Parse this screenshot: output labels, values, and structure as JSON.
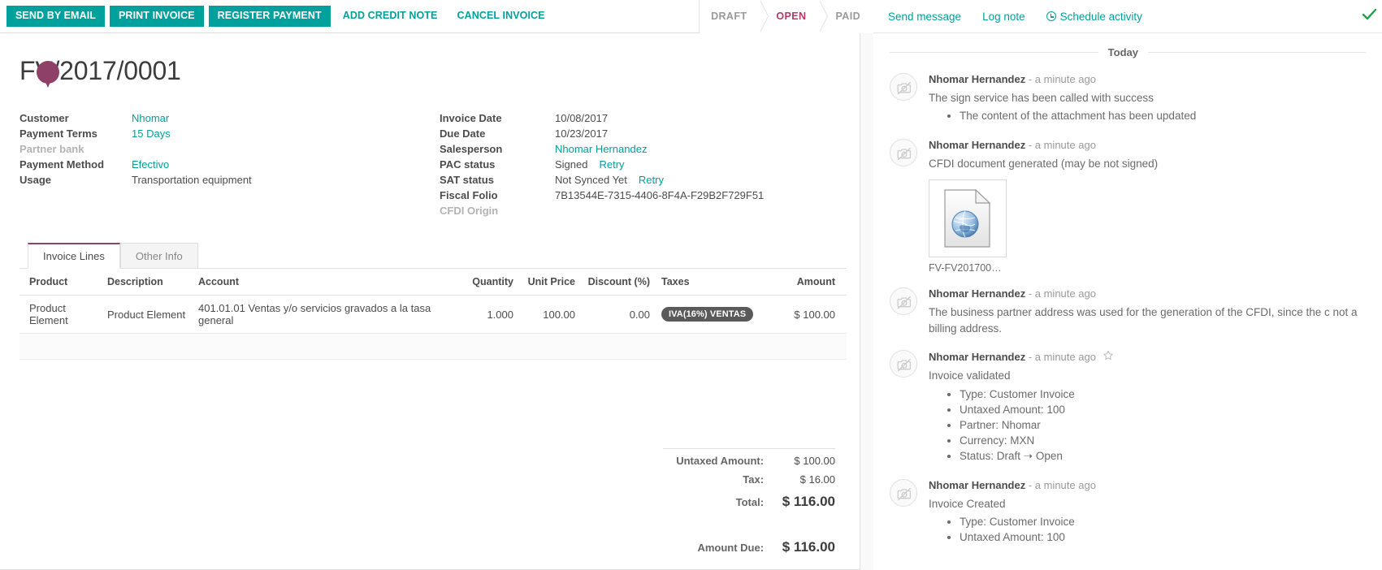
{
  "toolbar": {
    "buttons": [
      {
        "label": "SEND BY EMAIL",
        "style": "primary",
        "name": "send-by-email-button"
      },
      {
        "label": "PRINT INVOICE",
        "style": "primary",
        "name": "print-invoice-button"
      },
      {
        "label": "REGISTER PAYMENT",
        "style": "primary",
        "name": "register-payment-button"
      },
      {
        "label": "ADD CREDIT NOTE",
        "style": "link",
        "name": "add-credit-note-button"
      },
      {
        "label": "CANCEL INVOICE",
        "style": "link",
        "name": "cancel-invoice-button"
      }
    ]
  },
  "statusbar": {
    "steps": [
      {
        "label": "DRAFT",
        "active": false
      },
      {
        "label": "OPEN",
        "active": true
      },
      {
        "label": "PAID",
        "active": false
      }
    ],
    "active_color": "#b5396b",
    "inactive_color": "#9a9a9a"
  },
  "record": {
    "title": "FV/2017/0001"
  },
  "fields_left": [
    {
      "label": "Customer",
      "value": "Nhomar",
      "link": true,
      "muted": false
    },
    {
      "label": "Payment Terms",
      "value": "15 Days",
      "link": true,
      "muted": false
    },
    {
      "label": "Partner bank",
      "value": "",
      "link": false,
      "muted": true
    },
    {
      "label": "Payment Method",
      "value": "Efectivo",
      "link": true,
      "muted": false
    },
    {
      "label": "Usage",
      "value": "Transportation equipment",
      "link": false,
      "muted": false
    }
  ],
  "fields_right": [
    {
      "label": "Invoice Date",
      "value": "10/08/2017",
      "link": false,
      "muted": false,
      "retry": ""
    },
    {
      "label": "Due Date",
      "value": "10/23/2017",
      "link": false,
      "muted": false,
      "retry": ""
    },
    {
      "label": "Salesperson",
      "value": "Nhomar Hernandez",
      "link": true,
      "muted": false,
      "retry": ""
    },
    {
      "label": "PAC status",
      "value": "Signed",
      "link": false,
      "muted": false,
      "retry": "Retry"
    },
    {
      "label": "SAT status",
      "value": "Not Synced Yet",
      "link": false,
      "muted": false,
      "retry": "Retry"
    },
    {
      "label": "Fiscal Folio",
      "value": "7B13544E-7315-4406-8F4A-F29B2F729F51",
      "link": false,
      "muted": false,
      "retry": ""
    },
    {
      "label": "CFDI Origin",
      "value": "",
      "link": false,
      "muted": true,
      "retry": ""
    }
  ],
  "notebook": {
    "tabs": [
      {
        "label": "Invoice Lines",
        "active": true
      },
      {
        "label": "Other Info",
        "active": false
      }
    ]
  },
  "lines_table": {
    "headers": {
      "product": "Product",
      "description": "Description",
      "account": "Account",
      "quantity": "Quantity",
      "unit_price": "Unit Price",
      "discount": "Discount (%)",
      "taxes": "Taxes",
      "amount": "Amount"
    },
    "rows": [
      {
        "product": "Product Element",
        "description": "Product Element",
        "account": "401.01.01 Ventas y/o servicios gravados a la tasa general",
        "quantity": "1.000",
        "unit_price": "100.00",
        "discount": "0.00",
        "taxes": "IVA(16%) VENTAS",
        "amount": "$ 100.00"
      }
    ]
  },
  "totals": {
    "untaxed_label": "Untaxed Amount:",
    "untaxed_value": "$ 100.00",
    "tax_label": "Tax:",
    "tax_value": "$ 16.00",
    "total_label": "Total:",
    "total_value": "$ 116.00",
    "amount_due_label": "Amount Due:",
    "amount_due_value": "$ 116.00"
  },
  "chatter": {
    "actions": [
      {
        "label": "Send message",
        "icon": "",
        "name": "send-message-button"
      },
      {
        "label": "Log note",
        "icon": "",
        "name": "log-note-button"
      },
      {
        "label": "Schedule activity",
        "icon": "clock-icon",
        "name": "schedule-activity-button"
      }
    ],
    "day_separator": "Today",
    "messages": [
      {
        "author": "Nhomar Hernandez",
        "time": "- a minute ago",
        "body": "The sign service has been called with success",
        "bullets": [
          "The content of the attachment has been updated"
        ],
        "starred": false,
        "attachment": null
      },
      {
        "author": "Nhomar Hernandez",
        "time": "- a minute ago",
        "body": "CFDI document generated (may be not signed)",
        "bullets": [],
        "starred": false,
        "attachment": {
          "filename": "FV-FV201700…",
          "icon": "xml-globe-file-icon"
        }
      },
      {
        "author": "Nhomar Hernandez",
        "time": "- a minute ago",
        "body": "The business partner address was used for the generation of the CFDI, since the c not a billing address.",
        "bullets": [],
        "starred": false,
        "attachment": null
      },
      {
        "author": "Nhomar Hernandez",
        "time": "- a minute ago",
        "body": "Invoice validated",
        "bullets": [
          "Type: Customer Invoice",
          "Untaxed Amount: 100",
          "Partner: Nhomar",
          "Currency: MXN",
          "Status: Draft ➝ Open"
        ],
        "starred": true,
        "attachment": null
      },
      {
        "author": "Nhomar Hernandez",
        "time": "- a minute ago",
        "body": "Invoice Created",
        "bullets": [
          "Type: Customer Invoice",
          "Untaxed Amount: 100"
        ],
        "starred": false,
        "attachment": null
      }
    ]
  },
  "colors": {
    "accent": "#00a09d",
    "status_active": "#b5396b",
    "badge": "#5a5a5a",
    "pin": "#8f4068",
    "check": "#1aa34a"
  }
}
